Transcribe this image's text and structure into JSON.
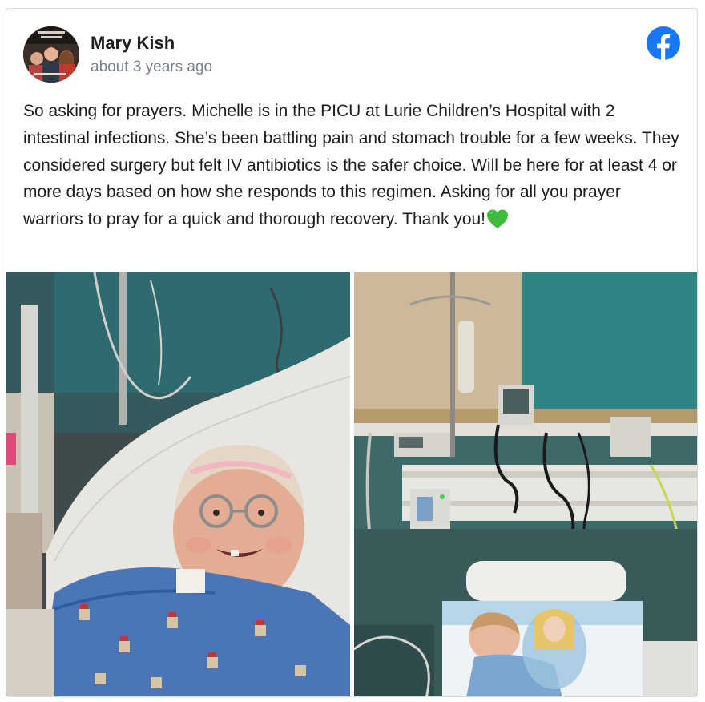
{
  "post": {
    "author_name": "Mary Kish",
    "timestamp": "about 3 years ago",
    "platform_icon": "facebook-icon",
    "text": "So asking for prayers. Michelle is in the PICU at Lurie Children’s Hospital with 2 intestinal infections. She’s been battling pain and stomach trouble for a few weeks. They considered surgery but felt IV antibiotics is the safer choice. Will be here for at least 4 or more days based on how she responds to this regimen. Asking for all you prayer warriors to pray for a quick and thorough recovery. Thank you!",
    "emoji": "green-heart-emoji"
  },
  "colors": {
    "facebook_blue": "#1877f2",
    "text_primary": "#1c1e21",
    "text_secondary": "#7a7f87",
    "green_heart": "#3dbb3d",
    "card_border": "#d6d9dd"
  }
}
